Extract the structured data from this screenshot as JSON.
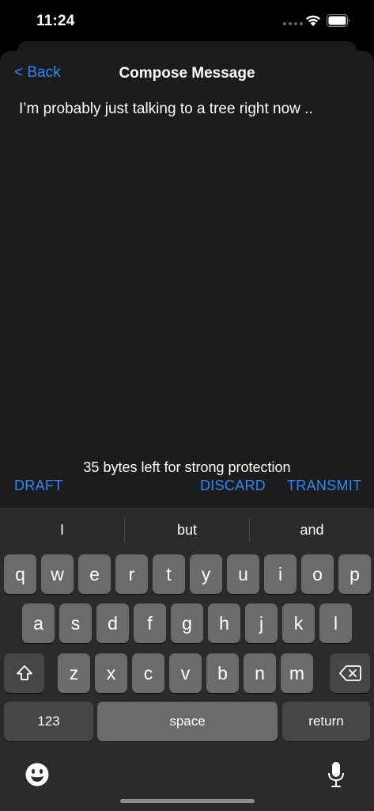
{
  "status_bar": {
    "time": "11:24"
  },
  "nav": {
    "back_label": "< Back",
    "title": "Compose Message"
  },
  "message": {
    "text": "I’m probably just talking to a tree right now .."
  },
  "footer": {
    "bytes_left": "35 bytes left for strong protection",
    "draft_label": "DRAFT",
    "discard_label": "DISCARD",
    "transmit_label": "TRANSMIT"
  },
  "keyboard": {
    "suggestions": [
      "I",
      "but",
      "and"
    ],
    "row1": [
      "q",
      "w",
      "e",
      "r",
      "t",
      "y",
      "u",
      "i",
      "o",
      "p"
    ],
    "row2": [
      "a",
      "s",
      "d",
      "f",
      "g",
      "h",
      "j",
      "k",
      "l"
    ],
    "row3": [
      "z",
      "x",
      "c",
      "v",
      "b",
      "n",
      "m"
    ],
    "numbers_label": "123",
    "space_label": "space",
    "return_label": "return"
  },
  "colors": {
    "accent": "#2f86f6",
    "sheet": "#1c1c1e",
    "keyboard": "#2b2b2d",
    "key": "#6b6b6e",
    "key_dark": "#464649"
  },
  "icons": [
    "wifi-icon",
    "battery-icon",
    "shift-icon",
    "backspace-icon",
    "emoji-icon",
    "microphone-icon"
  ]
}
